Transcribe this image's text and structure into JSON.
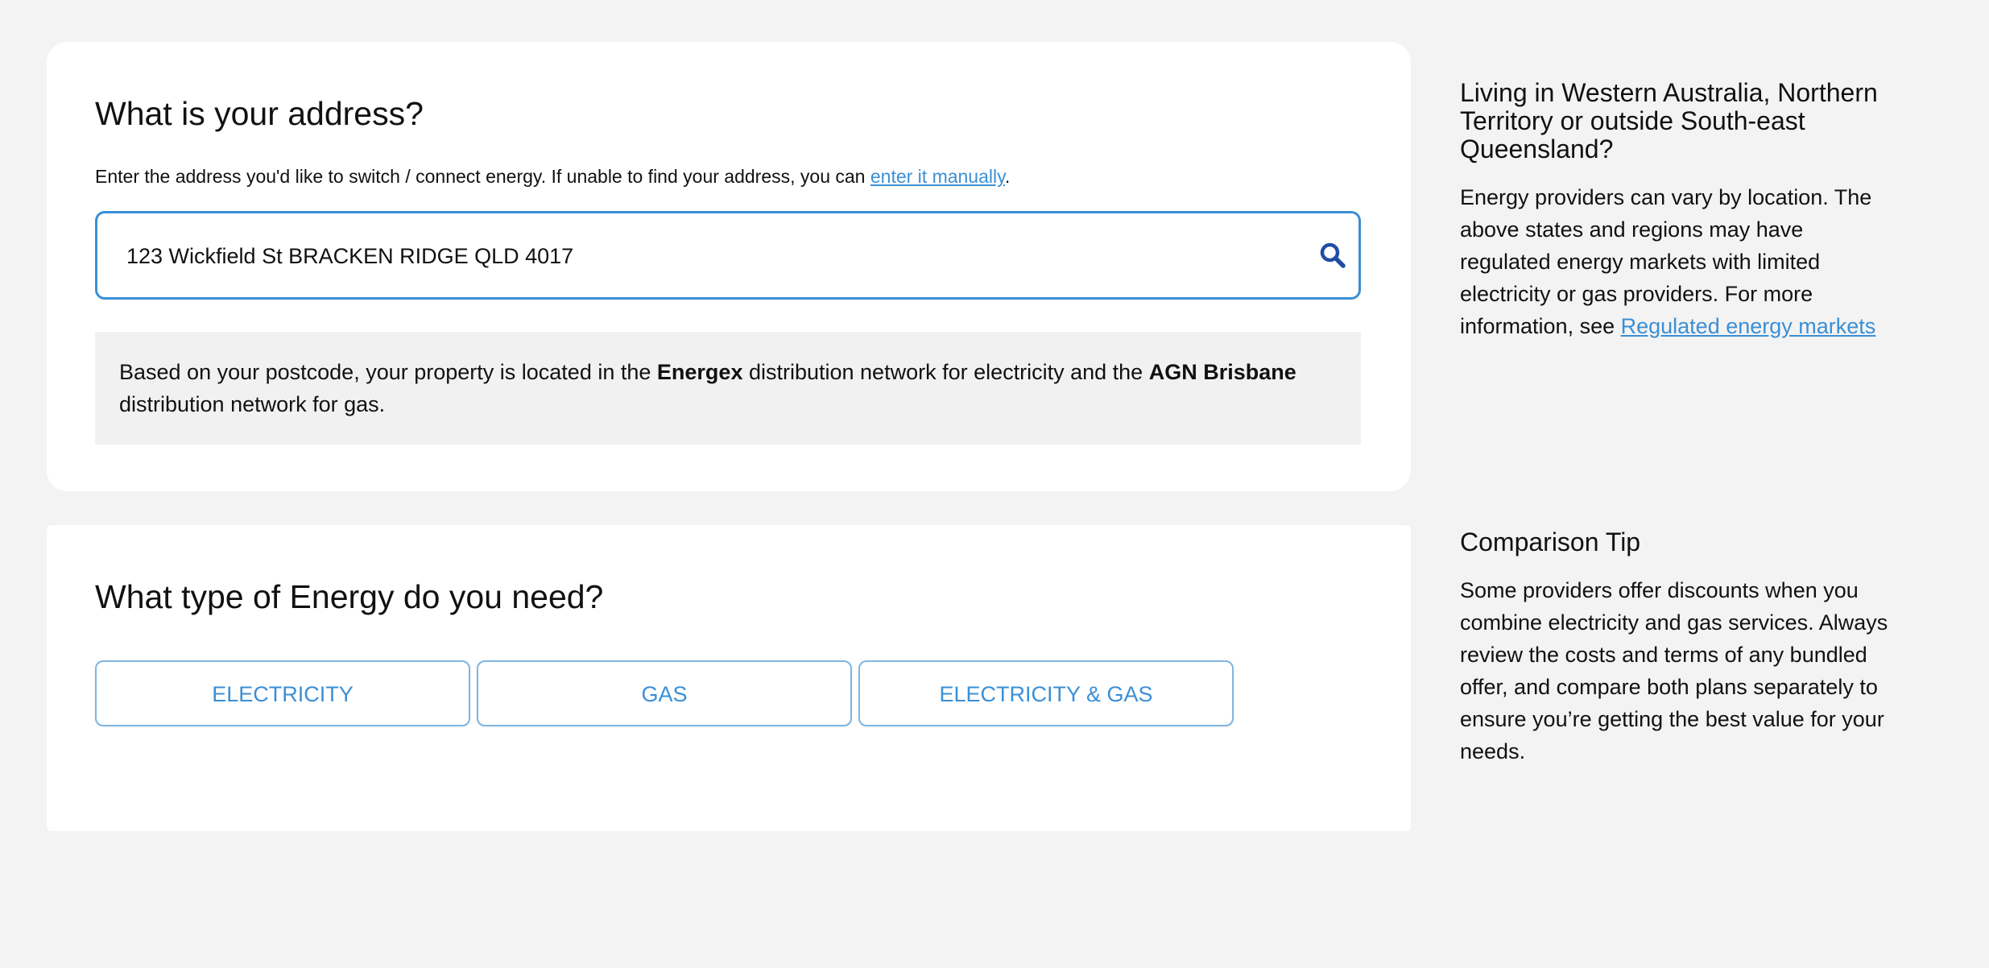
{
  "address": {
    "title": "What is your address?",
    "intro_text": "Enter the address you'd like to switch / connect energy. If unable to find your address, you can ",
    "intro_link": "enter it manually",
    "intro_end": ".",
    "input_value": "123 Wickfield St BRACKEN RIDGE QLD 4017",
    "search_icon": "search-icon",
    "notice": {
      "part1": "Based on your postcode, your property is located in the ",
      "bold1": "Energex",
      "part2": " distribution network for electricity and the ",
      "bold2": "AGN Brisbane",
      "part3": " distribution network for gas."
    }
  },
  "energy": {
    "title": "What type of Energy do you need?",
    "options": [
      "ELECTRICITY",
      "GAS",
      "ELECTRICITY & GAS"
    ]
  },
  "sidebar": {
    "location": {
      "heading": "Living in Western Australia, Northern Territory or outside South-east Queensland?",
      "body": "Energy providers can vary by location. The above states and regions may have regulated energy markets with limited electricity or gas providers. For more information, see ",
      "link": "Regulated energy markets"
    },
    "tip": {
      "heading": "Comparison Tip",
      "body": "Some providers offer discounts when you combine electricity and gas services. Always review the costs and terms of any bundled offer, and compare both plans separately to ensure you’re getting the best value for your needs."
    }
  },
  "colors": {
    "accent": "#3a8fd6",
    "search_icon": "#1f4fa3",
    "background": "#f3f3f3",
    "notice_bg": "#f1f1f1"
  }
}
